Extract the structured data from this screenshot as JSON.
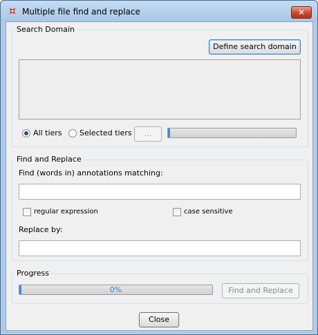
{
  "window": {
    "title": "Multiple file find and replace",
    "close_glyph": "✕"
  },
  "search_domain": {
    "legend": "Search Domain",
    "define_button": "Define search domain",
    "all_tiers_label": "All tiers",
    "selected_tiers_label": "Selected tiers",
    "tier_option_selected": "All tiers",
    "browse_button": "...",
    "domain_progress": 0
  },
  "find_replace": {
    "legend": "Find and Replace",
    "find_label": "Find (words in) annotations matching:",
    "find_value": "",
    "regex_label": "regular expression",
    "regex_checked": false,
    "case_label": "case sensitive",
    "case_checked": false,
    "replace_label": "Replace by:",
    "replace_value": ""
  },
  "progress": {
    "legend": "Progress",
    "percent_text": "0%",
    "value": 0,
    "action_button": "Find and Replace"
  },
  "footer": {
    "close_button": "Close"
  },
  "colors": {
    "progress_fill": "#3c8be0",
    "window_frame": "#aecbe8",
    "close_button": "#c8492e"
  }
}
